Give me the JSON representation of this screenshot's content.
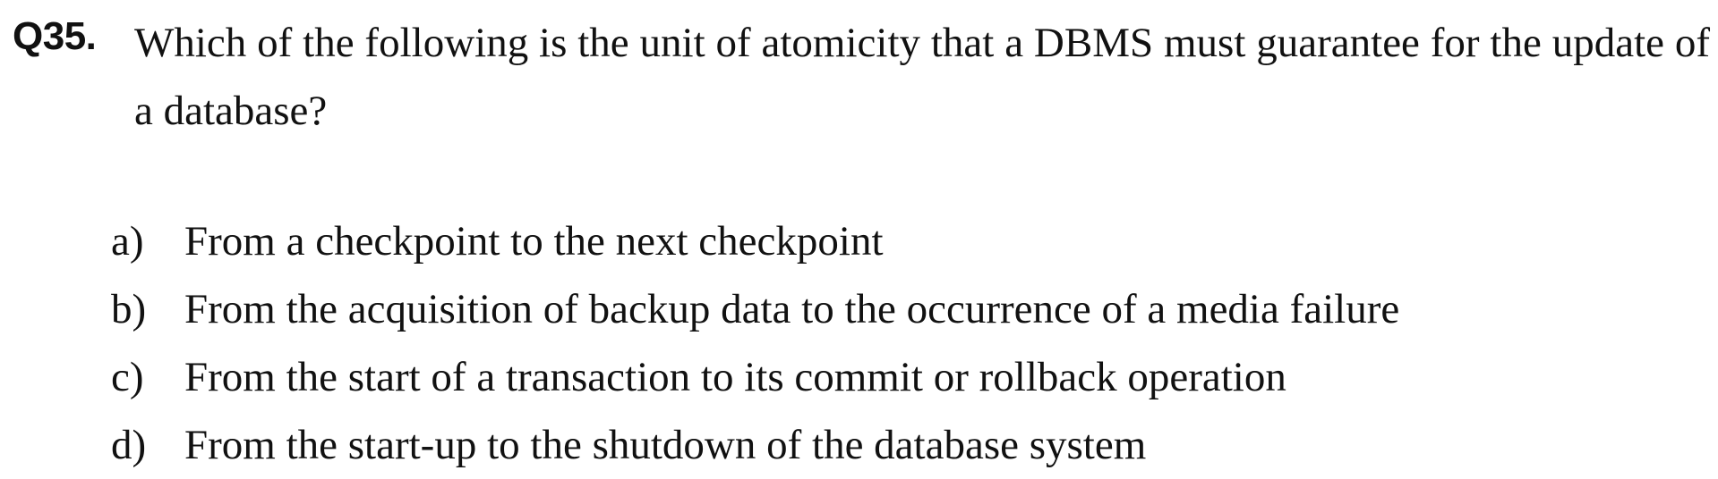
{
  "question": {
    "number": "Q35.",
    "text": "Which of the following is the unit of atomicity that a DBMS must guarantee for the update of a database?",
    "options": [
      {
        "letter": "a)",
        "text": "From a checkpoint to the next checkpoint"
      },
      {
        "letter": "b)",
        "text": "From the acquisition of backup data to the occurrence of a media failure"
      },
      {
        "letter": "c)",
        "text": "From the start of a transaction to its commit or rollback operation"
      },
      {
        "letter": "d)",
        "text": "From the start-up to the shutdown of the database system"
      }
    ]
  }
}
